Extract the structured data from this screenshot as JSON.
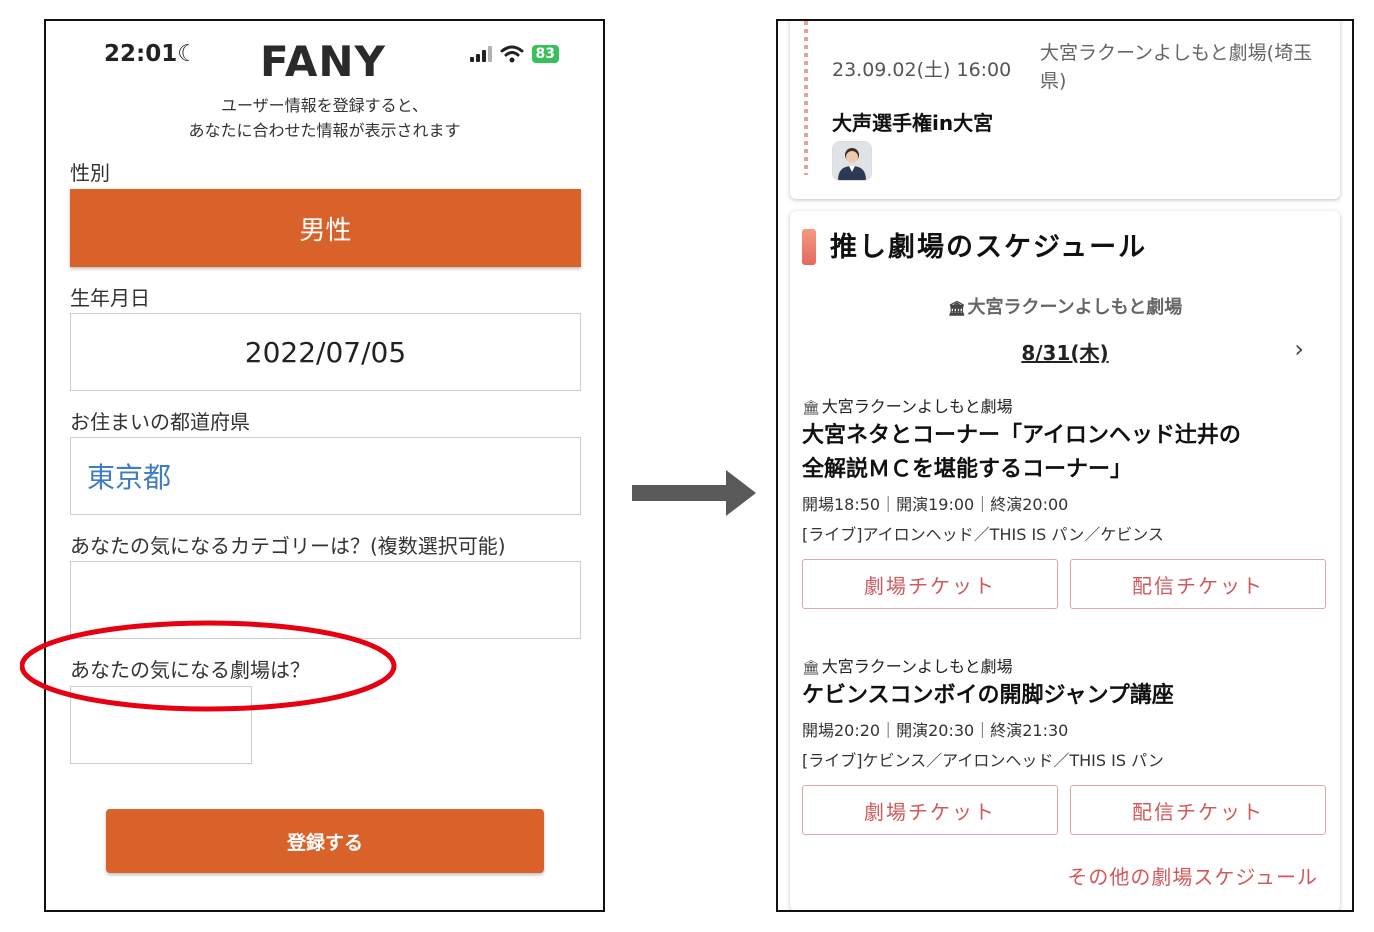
{
  "left_screen": {
    "status": {
      "time": "22:01",
      "battery": "83"
    },
    "logo": "FANY",
    "intro_lines": [
      "ユーザー情報を登録すると、",
      "あなたに合わせた情報が表示されます"
    ],
    "gender": {
      "label": "性別",
      "value": "男性"
    },
    "birthdate": {
      "label": "生年月日",
      "value": "2022/07/05"
    },
    "prefecture": {
      "label": "お住まいの都道府県",
      "value": "東京都"
    },
    "category": {
      "label": "あなたの気になるカテゴリーは？(複数選択可能)",
      "value": ""
    },
    "theater": {
      "label": "あなたの気になる劇場は？",
      "value": ""
    },
    "register_button": "登録する"
  },
  "right_screen": {
    "top_event": {
      "date": "23.09.02(土) 16:00",
      "venue": "大宮ラクーンよしもと劇場(埼玉県)",
      "title": "大声選手権in大宮"
    },
    "schedule": {
      "heading": "推し劇場のスケジュール",
      "venue": "大宮ラクーンよしもと劇場",
      "date": "8/31(木)",
      "events": [
        {
          "venue": "大宮ラクーンよしもと劇場",
          "title_lines": [
            "大宮ネタとコーナー「アイロンヘッド辻井の",
            "全解説ＭＣを堪能するコーナー」"
          ],
          "times": "開場18:50｜開演19:00｜終演20:00",
          "cast": "[ライブ]アイロンヘッド／THIS IS パン／ケビンス",
          "venue_ticket": "劇場チケット",
          "stream_ticket": "配信チケット"
        },
        {
          "venue": "大宮ラクーンよしもと劇場",
          "title_lines": [
            "ケビンスコンボイの開脚ジャンプ講座"
          ],
          "times": "開場20:20｜開演20:30｜終演21:30",
          "cast": "[ライブ]ケビンス／アイロンヘッド／THIS IS パン",
          "venue_ticket": "劇場チケット",
          "stream_ticket": "配信チケット"
        }
      ],
      "more_link": "その他の劇場スケジュール"
    }
  },
  "colors": {
    "accent_orange": "#d9622a",
    "ticket_red": "#d2585a",
    "highlight_red": "#e60012",
    "arrow_gray": "#595959"
  }
}
